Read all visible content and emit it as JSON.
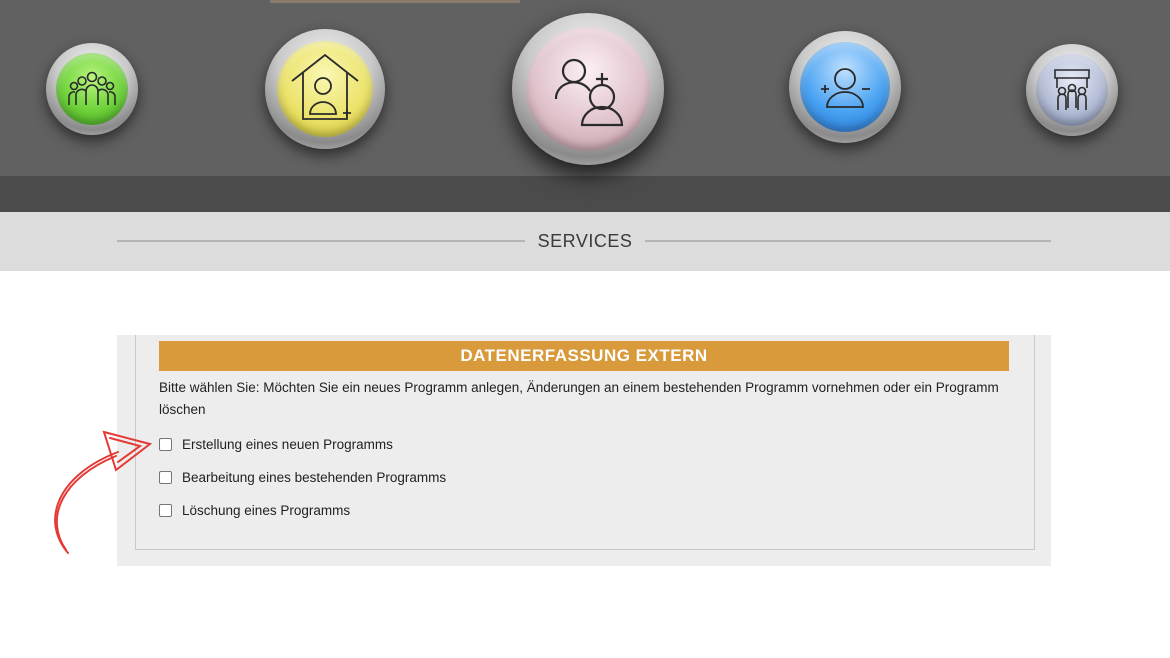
{
  "nav": {
    "items": [
      {
        "name": "team",
        "icon": "group-icon",
        "color": "#7fd84a"
      },
      {
        "name": "home-add",
        "icon": "house-person-add-icon",
        "color": "#e8e06a"
      },
      {
        "name": "users-add",
        "icon": "users-add-icon",
        "color": "#d9b8c3"
      },
      {
        "name": "user-add-remove",
        "icon": "user-plus-minus-icon",
        "color": "#3f9bef"
      },
      {
        "name": "people-banner",
        "icon": "people-banner-icon",
        "color": "#aab3cc"
      }
    ]
  },
  "services": {
    "title": "SERVICES"
  },
  "form": {
    "header": "DATENERFASSUNG EXTERN",
    "prompt": "Bitte wählen Sie: Möchten Sie ein neues Programm anlegen, Änderungen an einem bestehenden Programm vornehmen oder ein Programm löschen",
    "options": [
      {
        "label": "Erstellung eines neuen Programms",
        "checked": false
      },
      {
        "label": "Bearbeitung eines bestehenden Programms",
        "checked": false
      },
      {
        "label": "Löschung eines Programms",
        "checked": false
      }
    ],
    "header_color": "#d89a3a"
  },
  "annotation": {
    "arrow_color": "#e53935"
  }
}
